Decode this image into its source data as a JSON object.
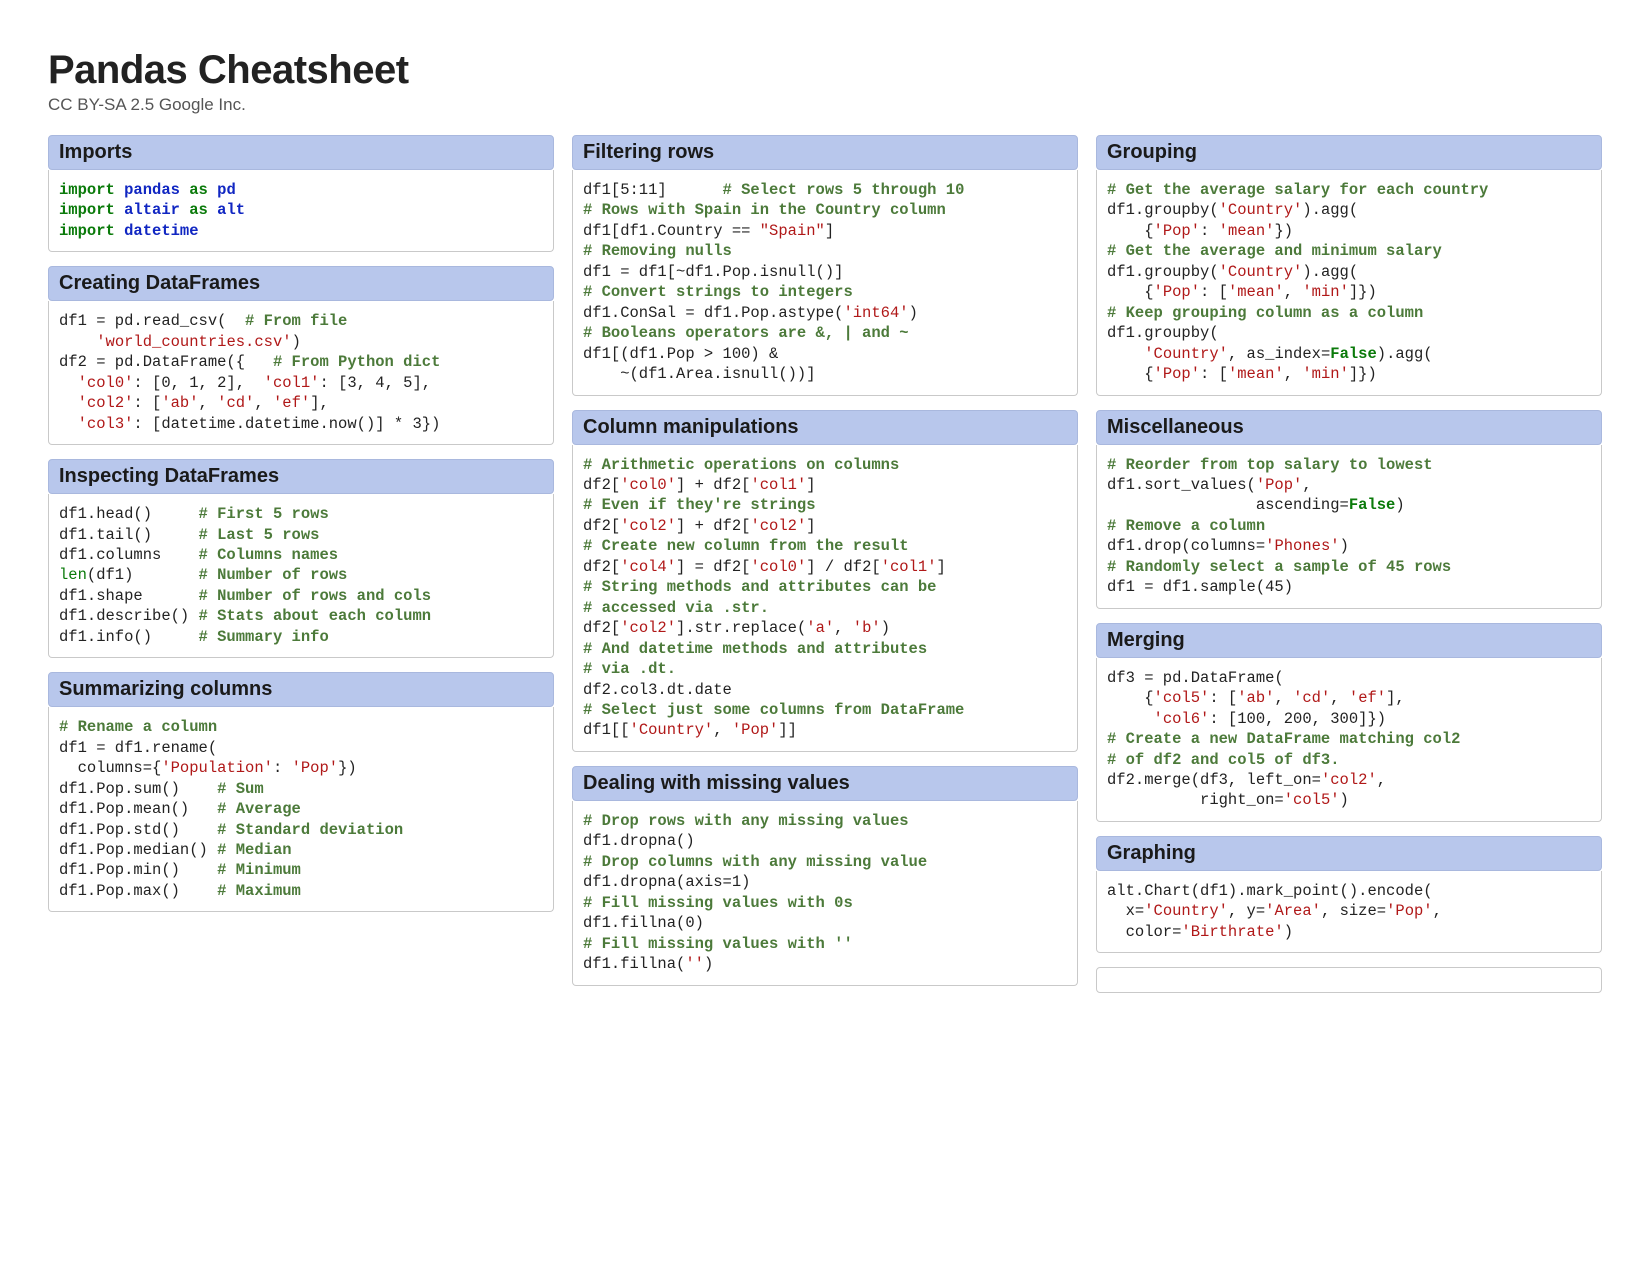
{
  "title": "Pandas Cheatsheet",
  "license": "CC BY-SA 2.5 Google Inc.",
  "columns": [
    {
      "sections": [
        {
          "header": "Imports",
          "code_html": "<span class='kw'>import</span> <span class='mod'>pandas</span> <span class='kw'>as</span> <span class='mod'>pd</span>\n<span class='kw'>import</span> <span class='mod'>altair</span> <span class='kw'>as</span> <span class='mod'>alt</span>\n<span class='kw'>import</span> <span class='mod'>datetime</span>"
        },
        {
          "header": "Creating DataFrames",
          "code_html": "df1 = pd.read_csv(  <span class='cm'># From file</span>\n    <span class='str'>'world_countries.csv'</span>)\ndf2 = pd.DataFrame({   <span class='cm'># From Python dict</span>\n  <span class='str'>'col0'</span>: [0, 1, 2],  <span class='str'>'col1'</span>: [3, 4, 5],\n  <span class='str'>'col2'</span>: [<span class='str'>'ab'</span>, <span class='str'>'cd'</span>, <span class='str'>'ef'</span>],\n  <span class='str'>'col3'</span>: [datetime.datetime.now()] * 3})"
        },
        {
          "header": "Inspecting DataFrames",
          "code_html": "df1.head()     <span class='cm'># First 5 rows</span>\ndf1.tail()     <span class='cm'># Last 5 rows</span>\ndf1.columns    <span class='cm'># Columns names</span>\n<span class='bi'>len</span>(df1)       <span class='cm'># Number of rows</span>\ndf1.shape      <span class='cm'># Number of rows and cols</span>\ndf1.describe() <span class='cm'># Stats about each column</span>\ndf1.info()     <span class='cm'># Summary info</span>"
        },
        {
          "header": "Summarizing columns",
          "code_html": "<span class='cm'># Rename a column</span>\ndf1 = df1.rename(\n  columns={<span class='str'>'Population'</span>: <span class='str'>'Pop'</span>})\ndf1.Pop.sum()    <span class='cm'># Sum</span>\ndf1.Pop.mean()   <span class='cm'># Average</span>\ndf1.Pop.std()    <span class='cm'># Standard deviation</span>\ndf1.Pop.median() <span class='cm'># Median</span>\ndf1.Pop.min()    <span class='cm'># Minimum</span>\ndf1.Pop.max()    <span class='cm'># Maximum</span>"
        }
      ]
    },
    {
      "sections": [
        {
          "header": "Filtering rows",
          "code_html": "df1[5:11]      <span class='cm'># Select rows 5 through 10</span>\n<span class='cm'># Rows with Spain in the Country column</span>\ndf1[df1.Country == <span class='str'>\"Spain\"</span>]\n<span class='cm'># Removing nulls</span>\ndf1 = df1[~df1.Pop.isnull()]\n<span class='cm'># Convert strings to integers</span>\ndf1.ConSal = df1.Pop.astype(<span class='str'>'int64'</span>)\n<span class='cm'># Booleans operators are &amp;, | and ~</span>\ndf1[(df1.Pop &gt; 100) &amp;\n    ~(df1.Area.isnull())]"
        },
        {
          "header": "Column manipulations",
          "code_html": "<span class='cm'># Arithmetic operations on columns</span>\ndf2[<span class='str'>'col0'</span>] + df2[<span class='str'>'col1'</span>]\n<span class='cm'># Even if they're strings</span>\ndf2[<span class='str'>'col2'</span>] + df2[<span class='str'>'col2'</span>]\n<span class='cm'># Create new column from the result</span>\ndf2[<span class='str'>'col4'</span>] = df2[<span class='str'>'col0'</span>] / df2[<span class='str'>'col1'</span>]\n<span class='cm'># String methods and attributes can be</span>\n<span class='cm'># accessed via .str.</span>\ndf2[<span class='str'>'col2'</span>].str.replace(<span class='str'>'a'</span>, <span class='str'>'b'</span>)\n<span class='cm'># And datetime methods and attributes</span>\n<span class='cm'># via .dt.</span>\ndf2.col3.dt.date\n<span class='cm'># Select just some columns from DataFrame</span>\ndf1[[<span class='str'>'Country'</span>, <span class='str'>'Pop'</span>]]"
        },
        {
          "header": "Dealing with missing values",
          "code_html": "<span class='cm'># Drop rows with any missing values</span>\ndf1.dropna()\n<span class='cm'># Drop columns with any missing value</span>\ndf1.dropna(axis=1)\n<span class='cm'># Fill missing values with 0s</span>\ndf1.fillna(0)\n<span class='cm'># Fill missing values with ''</span>\ndf1.fillna(<span class='str'>''</span>)"
        }
      ]
    },
    {
      "sections": [
        {
          "header": "Grouping",
          "code_html": "<span class='cm'># Get the average salary for each country</span>\ndf1.groupby(<span class='str'>'Country'</span>).agg(\n    {<span class='str'>'Pop'</span>: <span class='str'>'mean'</span>})\n<span class='cm'># Get the average and minimum salary</span>\ndf1.groupby(<span class='str'>'Country'</span>).agg(\n    {<span class='str'>'Pop'</span>: [<span class='str'>'mean'</span>, <span class='str'>'min'</span>]})\n<span class='cm'># Keep grouping column as a column</span>\ndf1.groupby(\n    <span class='str'>'Country'</span>, as_index=<span class='bool'>False</span>).agg(\n    {<span class='str'>'Pop'</span>: [<span class='str'>'mean'</span>, <span class='str'>'min'</span>]})"
        },
        {
          "header": "Miscellaneous",
          "code_html": "<span class='cm'># Reorder from top salary to lowest</span>\ndf1.sort_values(<span class='str'>'Pop'</span>,\n                ascending=<span class='bool'>False</span>)\n<span class='cm'># Remove a column</span>\ndf1.drop(columns=<span class='str'>'Phones'</span>)\n<span class='cm'># Randomly select a sample of 45 rows</span>\ndf1 = df1.sample(45)"
        },
        {
          "header": "Merging",
          "code_html": "df3 = pd.DataFrame(\n    {<span class='str'>'col5'</span>: [<span class='str'>'ab'</span>, <span class='str'>'cd'</span>, <span class='str'>'ef'</span>],\n     <span class='str'>'col6'</span>: [100, 200, 300]})\n<span class='cm'># Create a new DataFrame matching col2</span>\n<span class='cm'># of df2 and col5 of df3.</span>\ndf2.merge(df3, left_on=<span class='str'>'col2'</span>,\n          right_on=<span class='str'>'col5'</span>)"
        },
        {
          "header": "Graphing",
          "code_html": "alt.Chart(df1).mark_point().encode(\n  x=<span class='str'>'Country'</span>, y=<span class='str'>'Area'</span>, size=<span class='str'>'Pop'</span>,\n  color=<span class='str'>'Birthrate'</span>)"
        },
        {
          "header": "",
          "empty": true,
          "code_html": ""
        }
      ]
    }
  ]
}
